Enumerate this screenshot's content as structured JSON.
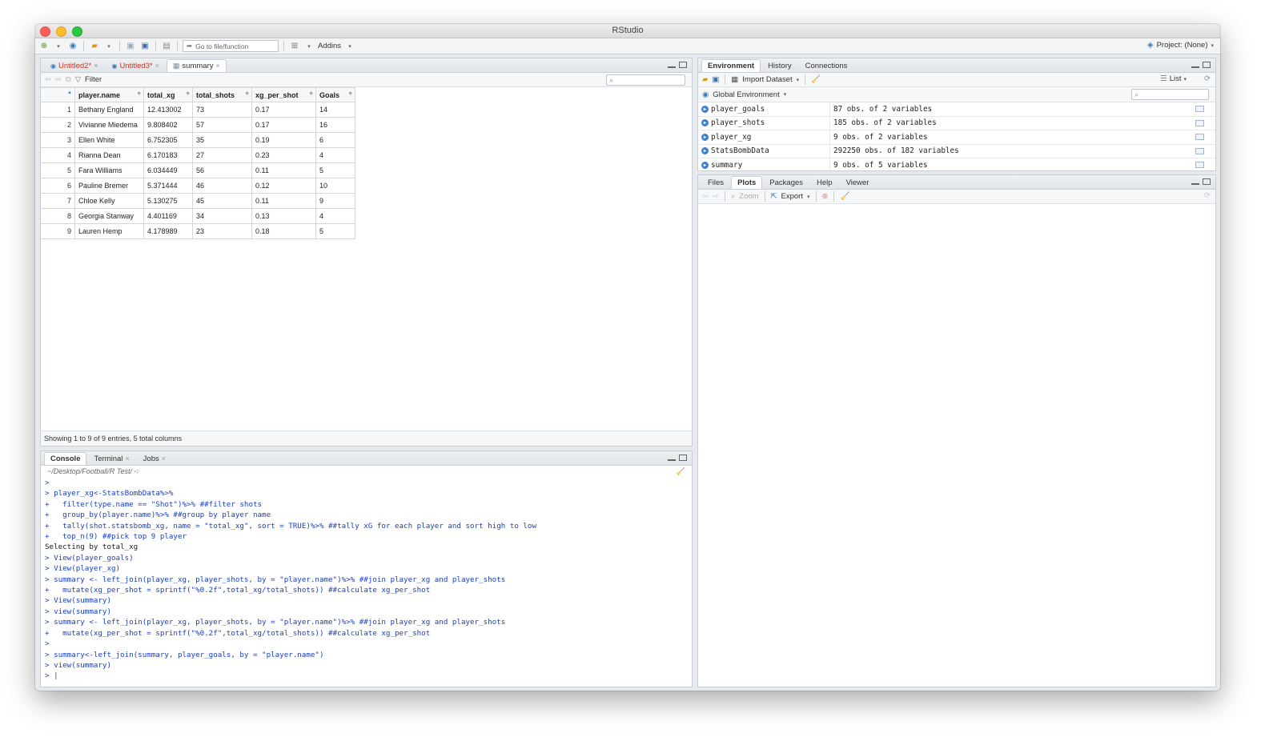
{
  "window": {
    "title": "RStudio"
  },
  "toolbar": {
    "goto_placeholder": "Go to file/function",
    "addins_label": "Addins",
    "project_label": "Project: (None)"
  },
  "source_pane": {
    "tabs": [
      {
        "label": "Untitled2*"
      },
      {
        "label": "Untitled3*"
      },
      {
        "label": "summary"
      }
    ],
    "filter_label": "Filter",
    "columns": [
      "player.name",
      "total_xg",
      "total_shots",
      "xg_per_shot",
      "Goals"
    ],
    "rows": [
      [
        "1",
        "Bethany England",
        "12.413002",
        "73",
        "0.17",
        "14"
      ],
      [
        "2",
        "Vivianne Miedema",
        "9.808402",
        "57",
        "0.17",
        "16"
      ],
      [
        "3",
        "Ellen White",
        "6.752305",
        "35",
        "0.19",
        "6"
      ],
      [
        "4",
        "Rianna Dean",
        "6.170183",
        "27",
        "0.23",
        "4"
      ],
      [
        "5",
        "Fara Williams",
        "6.034449",
        "56",
        "0.11",
        "5"
      ],
      [
        "6",
        "Pauline Bremer",
        "5.371444",
        "46",
        "0.12",
        "10"
      ],
      [
        "7",
        "Chloe Kelly",
        "5.130275",
        "45",
        "0.11",
        "9"
      ],
      [
        "8",
        "Georgia Stanway",
        "4.401169",
        "34",
        "0.13",
        "4"
      ],
      [
        "9",
        "Lauren Hemp",
        "4.178989",
        "23",
        "0.18",
        "5"
      ]
    ],
    "status": "Showing 1 to 9 of 9 entries, 5 total columns"
  },
  "console_pane": {
    "tabs": [
      "Console",
      "Terminal",
      "Jobs"
    ],
    "path": "~/Desktop/Football/R Test/",
    "lines": [
      {
        "t": "in",
        "text": ">"
      },
      {
        "t": "in",
        "text": "> player_xg<-StatsBombData%>%"
      },
      {
        "t": "in",
        "text": "+   filter(type.name == \"Shot\")%>% ##filter shots"
      },
      {
        "t": "in",
        "text": "+   group_by(player.name)%>% ##group by player name"
      },
      {
        "t": "in",
        "text": "+   tally(shot.statsbomb_xg, name = \"total_xg\", sort = TRUE)%>% ##tally xG for each player and sort high to low"
      },
      {
        "t": "in",
        "text": "+   top_n(9) ##pick top 9 player"
      },
      {
        "t": "out",
        "text": "Selecting by total_xg"
      },
      {
        "t": "in",
        "text": "> View(player_goals)"
      },
      {
        "t": "in",
        "text": "> View(player_xg)"
      },
      {
        "t": "in",
        "text": "> summary <- left_join(player_xg, player_shots, by = \"player.name\")%>% ##join player_xg and player_shots"
      },
      {
        "t": "in",
        "text": "+   mutate(xg_per_shot = sprintf(\"%0.2f\",total_xg/total_shots)) ##calculate xg_per_shot"
      },
      {
        "t": "in",
        "text": "> View(summary)"
      },
      {
        "t": "in",
        "text": "> view(summary)"
      },
      {
        "t": "in",
        "text": "> summary <- left_join(player_xg, player_shots, by = \"player.name\")%>% ##join player_xg and player_shots"
      },
      {
        "t": "in",
        "text": "+   mutate(xg_per_shot = sprintf(\"%0.2f\",total_xg/total_shots)) ##calculate xg_per_shot"
      },
      {
        "t": "in",
        "text": ">"
      },
      {
        "t": "in",
        "text": "> summary<-left_join(summary, player_goals, by = \"player.name\")"
      },
      {
        "t": "in",
        "text": "> view(summary)"
      },
      {
        "t": "in",
        "text": "> |"
      }
    ]
  },
  "env_pane": {
    "tabs": [
      "Environment",
      "History",
      "Connections"
    ],
    "import_label": "Import Dataset",
    "list_label": "List",
    "scope_label": "Global Environment",
    "objects": [
      {
        "name": "player_goals",
        "value": "87 obs. of 2 variables"
      },
      {
        "name": "player_shots",
        "value": "185 obs. of 2 variables"
      },
      {
        "name": "player_xg",
        "value": "9 obs. of 2 variables"
      },
      {
        "name": "StatsBombData",
        "value": "292250 obs. of 182 variables"
      },
      {
        "name": "summary",
        "value": "9 obs. of 5 variables"
      }
    ]
  },
  "files_pane": {
    "tabs": [
      "Files",
      "Plots",
      "Packages",
      "Help",
      "Viewer"
    ],
    "zoom_label": "Zoom",
    "export_label": "Export"
  }
}
